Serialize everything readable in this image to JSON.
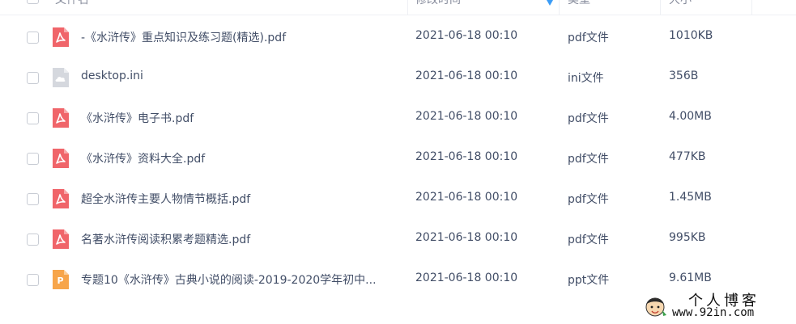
{
  "header": {
    "name_label": "文件名",
    "time_label": "修改时间",
    "type_label": "类型",
    "size_label": "大小"
  },
  "files": [
    {
      "name": "-《水浒传》重点知识及练习题(精选).pdf",
      "time": "2021-06-18 00:10",
      "type": "pdf文件",
      "size": "1010KB",
      "icon": "pdf-icon"
    },
    {
      "name": "desktop.ini",
      "time": "2021-06-18 00:10",
      "type": "ini文件",
      "size": "356B",
      "icon": "ini-file-icon"
    },
    {
      "name": "《水浒传》电子书.pdf",
      "time": "2021-06-18 00:10",
      "type": "pdf文件",
      "size": "4.00MB",
      "icon": "pdf-icon"
    },
    {
      "name": "《水浒传》资料大全.pdf",
      "time": "2021-06-18 00:10",
      "type": "pdf文件",
      "size": "477KB",
      "icon": "pdf-icon"
    },
    {
      "name": "超全水浒传主要人物情节概括.pdf",
      "time": "2021-06-18 00:10",
      "type": "pdf文件",
      "size": "1.45MB",
      "icon": "pdf-icon"
    },
    {
      "name": "名著水浒传阅读积累考题精选.pdf",
      "time": "2021-06-18 00:10",
      "type": "pdf文件",
      "size": "995KB",
      "icon": "pdf-icon"
    },
    {
      "name": "专题10《水浒传》古典小说的阅读-2019-2020学年初中...",
      "time": "2021-06-18 00:10",
      "type": "ppt文件",
      "size": "9.61MB",
      "icon": "ppt-icon"
    }
  ],
  "watermark": {
    "title": "个人博客",
    "url": "www.92in.com"
  },
  "colors": {
    "pdf": "#f0656a",
    "ppt": "#f7a54a",
    "ini": "#d5d8de",
    "sort_accent": "#3b9cf6"
  }
}
